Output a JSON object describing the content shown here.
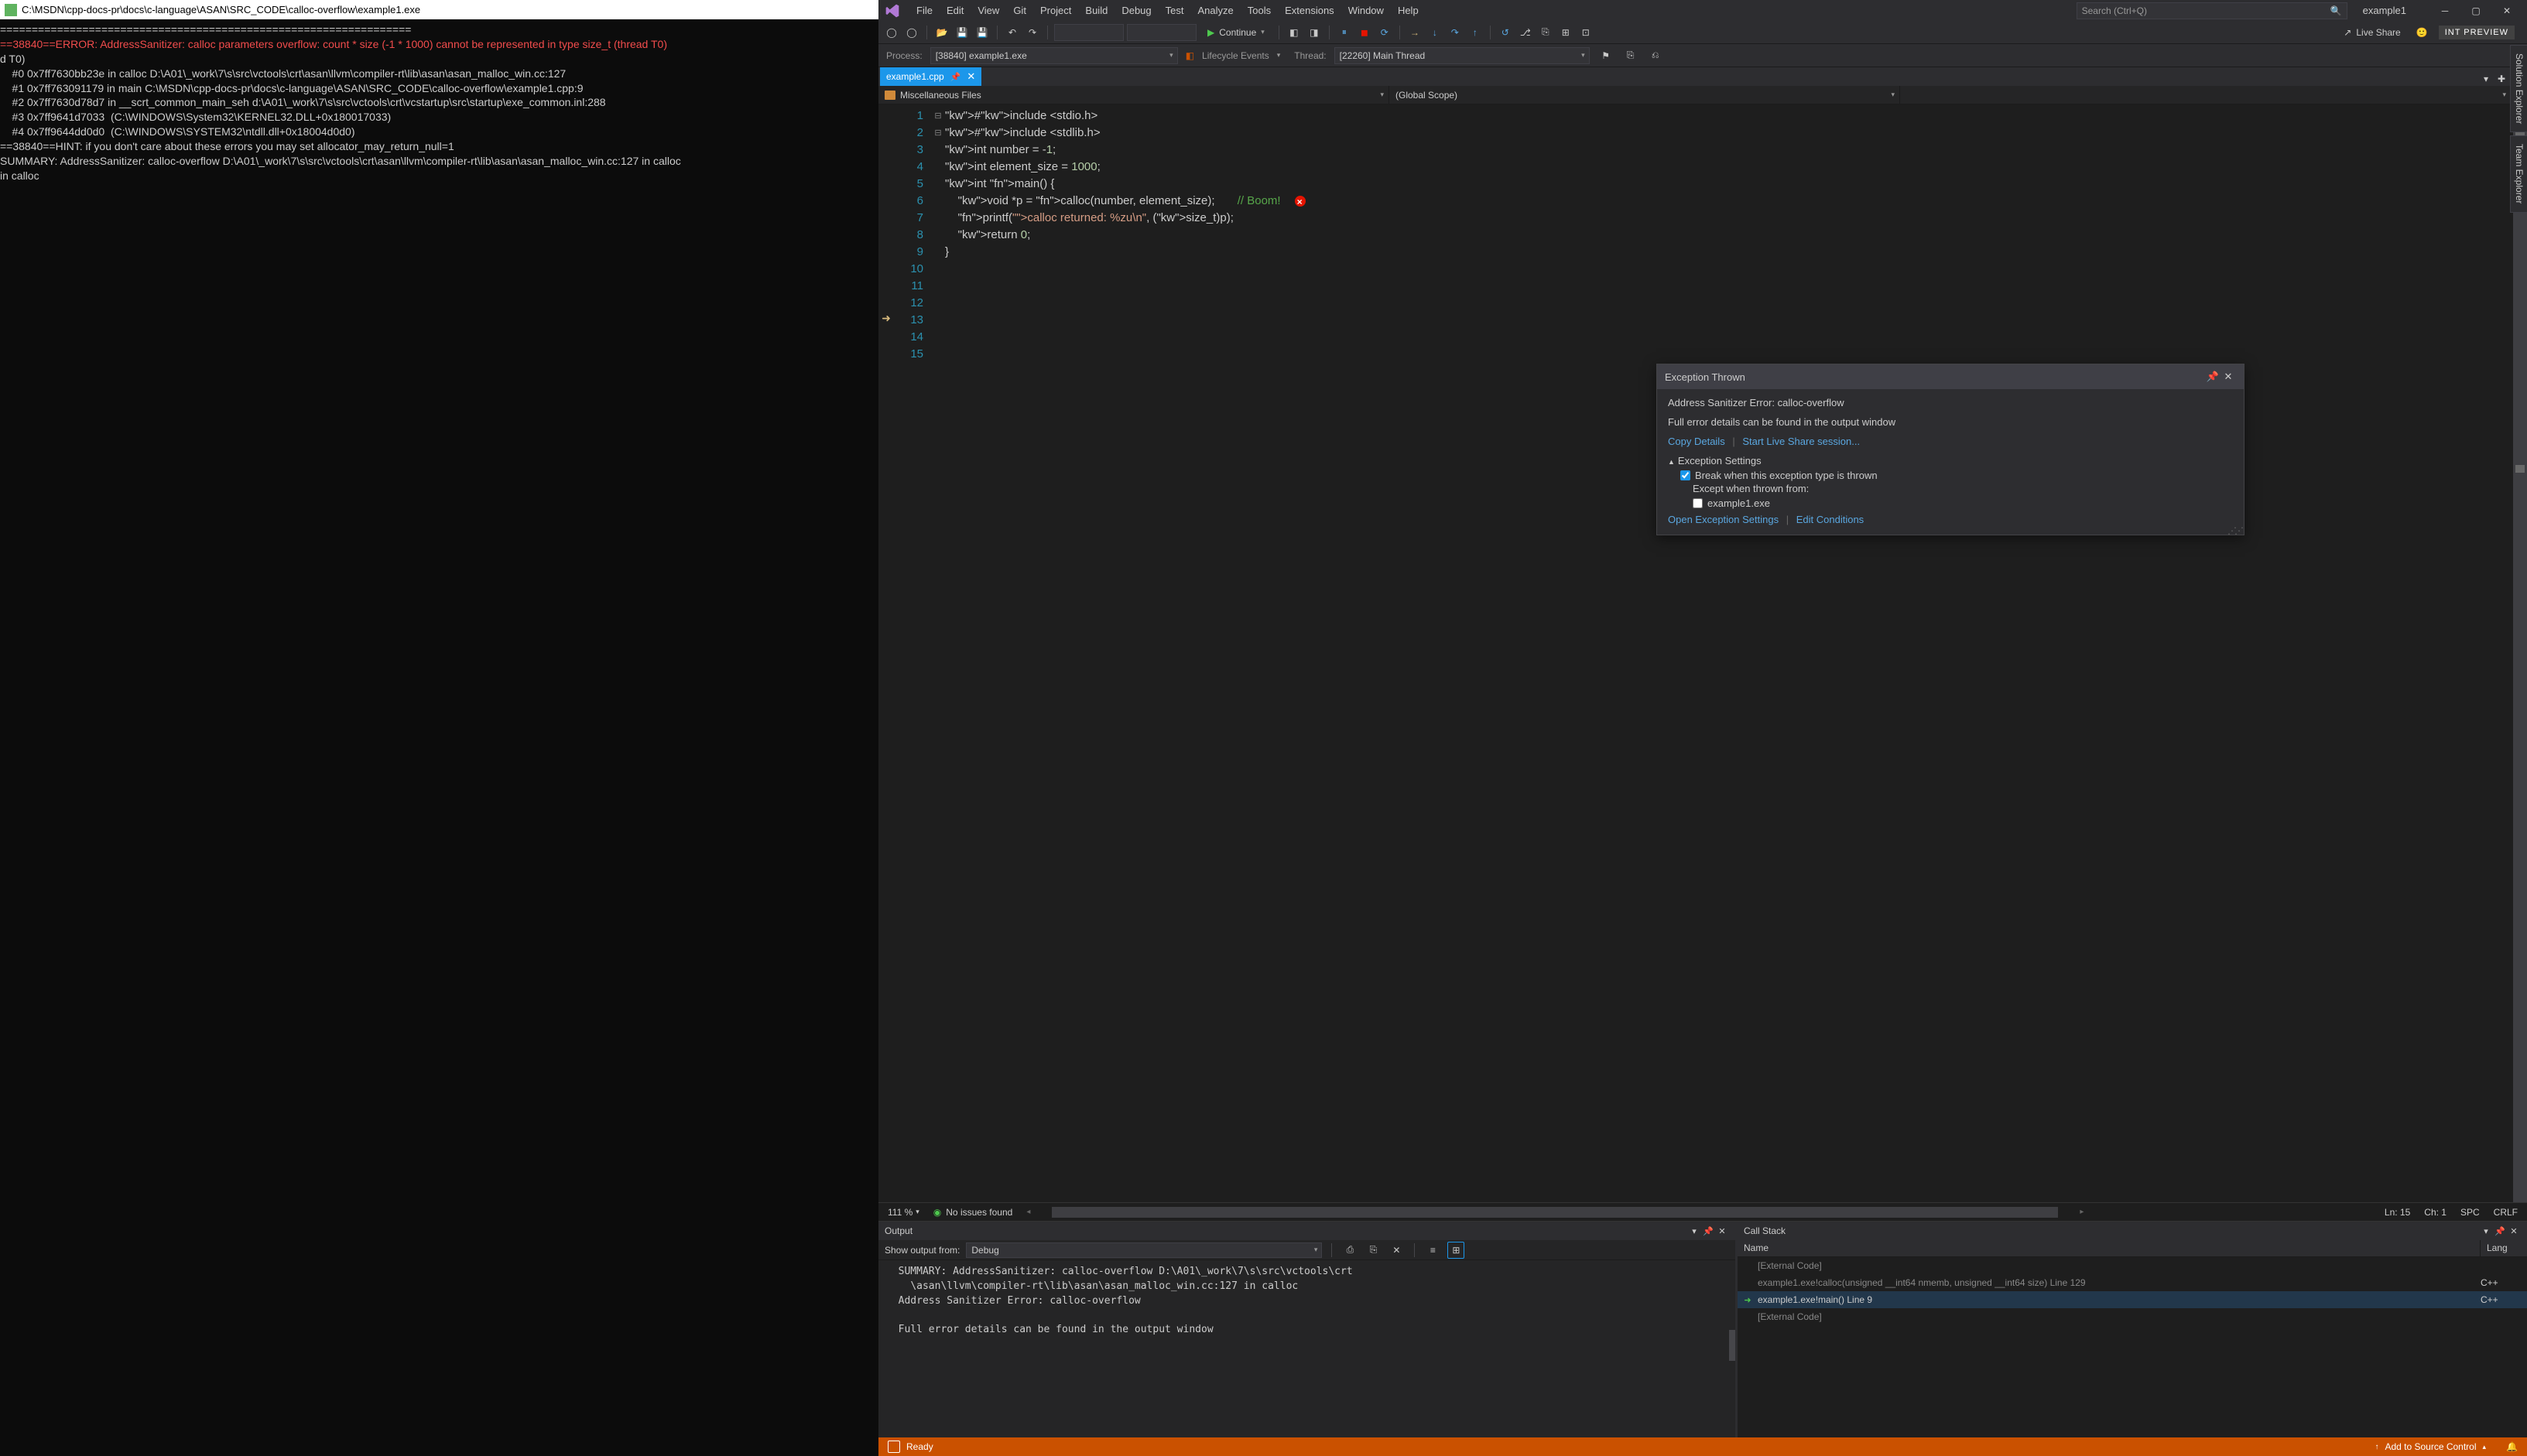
{
  "console": {
    "title": "C:\\MSDN\\cpp-docs-pr\\docs\\c-language\\ASAN\\SRC_CODE\\calloc-overflow\\example1.exe",
    "lines": [
      "=================================================================",
      "==38840==ERROR: AddressSanitizer: calloc parameters overflow: count * size (-1 * 1000) cannot be represented in type size_t (thread T0)",
      "d T0)",
      "    #0 0x7ff7630bb23e in calloc D:\\A01\\_work\\7\\s\\src\\vctools\\crt\\asan\\llvm\\compiler-rt\\lib\\asan\\asan_malloc_win.cc:127",
      "    #1 0x7ff763091179 in main C:\\MSDN\\cpp-docs-pr\\docs\\c-language\\ASAN\\SRC_CODE\\calloc-overflow\\example1.cpp:9",
      "    #2 0x7ff7630d78d7 in __scrt_common_main_seh d:\\A01\\_work\\7\\s\\src\\vctools\\crt\\vcstartup\\src\\startup\\exe_common.inl:288",
      "    #3 0x7ff9641d7033  (C:\\WINDOWS\\System32\\KERNEL32.DLL+0x180017033)",
      "    #4 0x7ff9644dd0d0  (C:\\WINDOWS\\SYSTEM32\\ntdll.dll+0x18004d0d0)",
      "",
      "==38840==HINT: if you don't care about these errors you may set allocator_may_return_null=1",
      "SUMMARY: AddressSanitizer: calloc-overflow D:\\A01\\_work\\7\\s\\src\\vctools\\crt\\asan\\llvm\\compiler-rt\\lib\\asan\\asan_malloc_win.cc:127 in calloc",
      "in calloc"
    ]
  },
  "menubar": [
    "File",
    "Edit",
    "View",
    "Git",
    "Project",
    "Build",
    "Debug",
    "Test",
    "Analyze",
    "Tools",
    "Extensions",
    "Window",
    "Help"
  ],
  "search_placeholder": "Search (Ctrl+Q)",
  "solution_name": "example1",
  "preview_badge": "INT PREVIEW",
  "continue_label": "Continue",
  "liveshare_label": "Live Share",
  "debugbar": {
    "process_label": "Process:",
    "process_value": "[38840] example1.exe",
    "lifecycle_label": "Lifecycle Events",
    "thread_label": "Thread:",
    "thread_value": "[22260] Main Thread"
  },
  "tab": {
    "name": "example1.cpp"
  },
  "nav": {
    "left": "Miscellaneous Files",
    "right": "(Global Scope)"
  },
  "code": {
    "line_numbers": [
      "1",
      "2",
      "3",
      "4",
      "5",
      "6",
      "7",
      "8",
      "9",
      "10",
      "11",
      "12",
      "13",
      "14",
      "15"
    ],
    "raw": [
      "#include <stdio.h>",
      "#include <stdlib.h>",
      "",
      "int number = -1;",
      "int element_size = 1000;",
      "",
      "int main() {",
      "",
      "    void *p = calloc(number, element_size);       // Boom!",
      "",
      "    printf(\"calloc returned: %zu\\n\", (size_t)p);",
      "",
      "    return 0;",
      "}",
      ""
    ]
  },
  "exception": {
    "title": "Exception Thrown",
    "error": "Address Sanitizer Error: calloc-overflow",
    "detail_hint": "Full error details can be found in the output window",
    "copy": "Copy Details",
    "liveshare": "Start Live Share session...",
    "settings_label": "Exception Settings",
    "break_label": "Break when this exception type is thrown",
    "except_label": "Except when thrown from:",
    "except_item": "example1.exe",
    "open_settings": "Open Exception Settings",
    "edit_conditions": "Edit Conditions"
  },
  "statusline": {
    "zoom": "111 %",
    "issues": "No issues found",
    "ln": "Ln: 15",
    "ch": "Ch: 1",
    "spc": "SPC",
    "eol": "CRLF"
  },
  "output": {
    "title": "Output",
    "show_from_label": "Show output from:",
    "show_from_value": "Debug",
    "text": "  SUMMARY: AddressSanitizer: calloc-overflow D:\\A01\\_work\\7\\s\\src\\vctools\\crt\n    \\asan\\llvm\\compiler-rt\\lib\\asan\\asan_malloc_win.cc:127 in calloc\n  Address Sanitizer Error: calloc-overflow\n\n  Full error details can be found in the output window\n"
  },
  "callstack": {
    "title": "Call Stack",
    "col_name": "Name",
    "col_lang": "Lang",
    "rows": [
      {
        "arrow": "",
        "name": "[External Code]",
        "lang": "",
        "dim": true
      },
      {
        "arrow": "",
        "name": "example1.exe!calloc(unsigned __int64 nmemb, unsigned __int64 size) Line 129",
        "lang": "C++",
        "dim": true
      },
      {
        "arrow": "➜",
        "name": "example1.exe!main() Line 9",
        "lang": "C++",
        "dim": false,
        "active": true,
        "arrowclass": "green"
      },
      {
        "arrow": "",
        "name": "[External Code]",
        "lang": "",
        "dim": true
      }
    ]
  },
  "vs_status": {
    "ready": "Ready",
    "source_control": "Add to Source Control"
  },
  "side_tabs": [
    "Solution Explorer",
    "Team Explorer"
  ]
}
